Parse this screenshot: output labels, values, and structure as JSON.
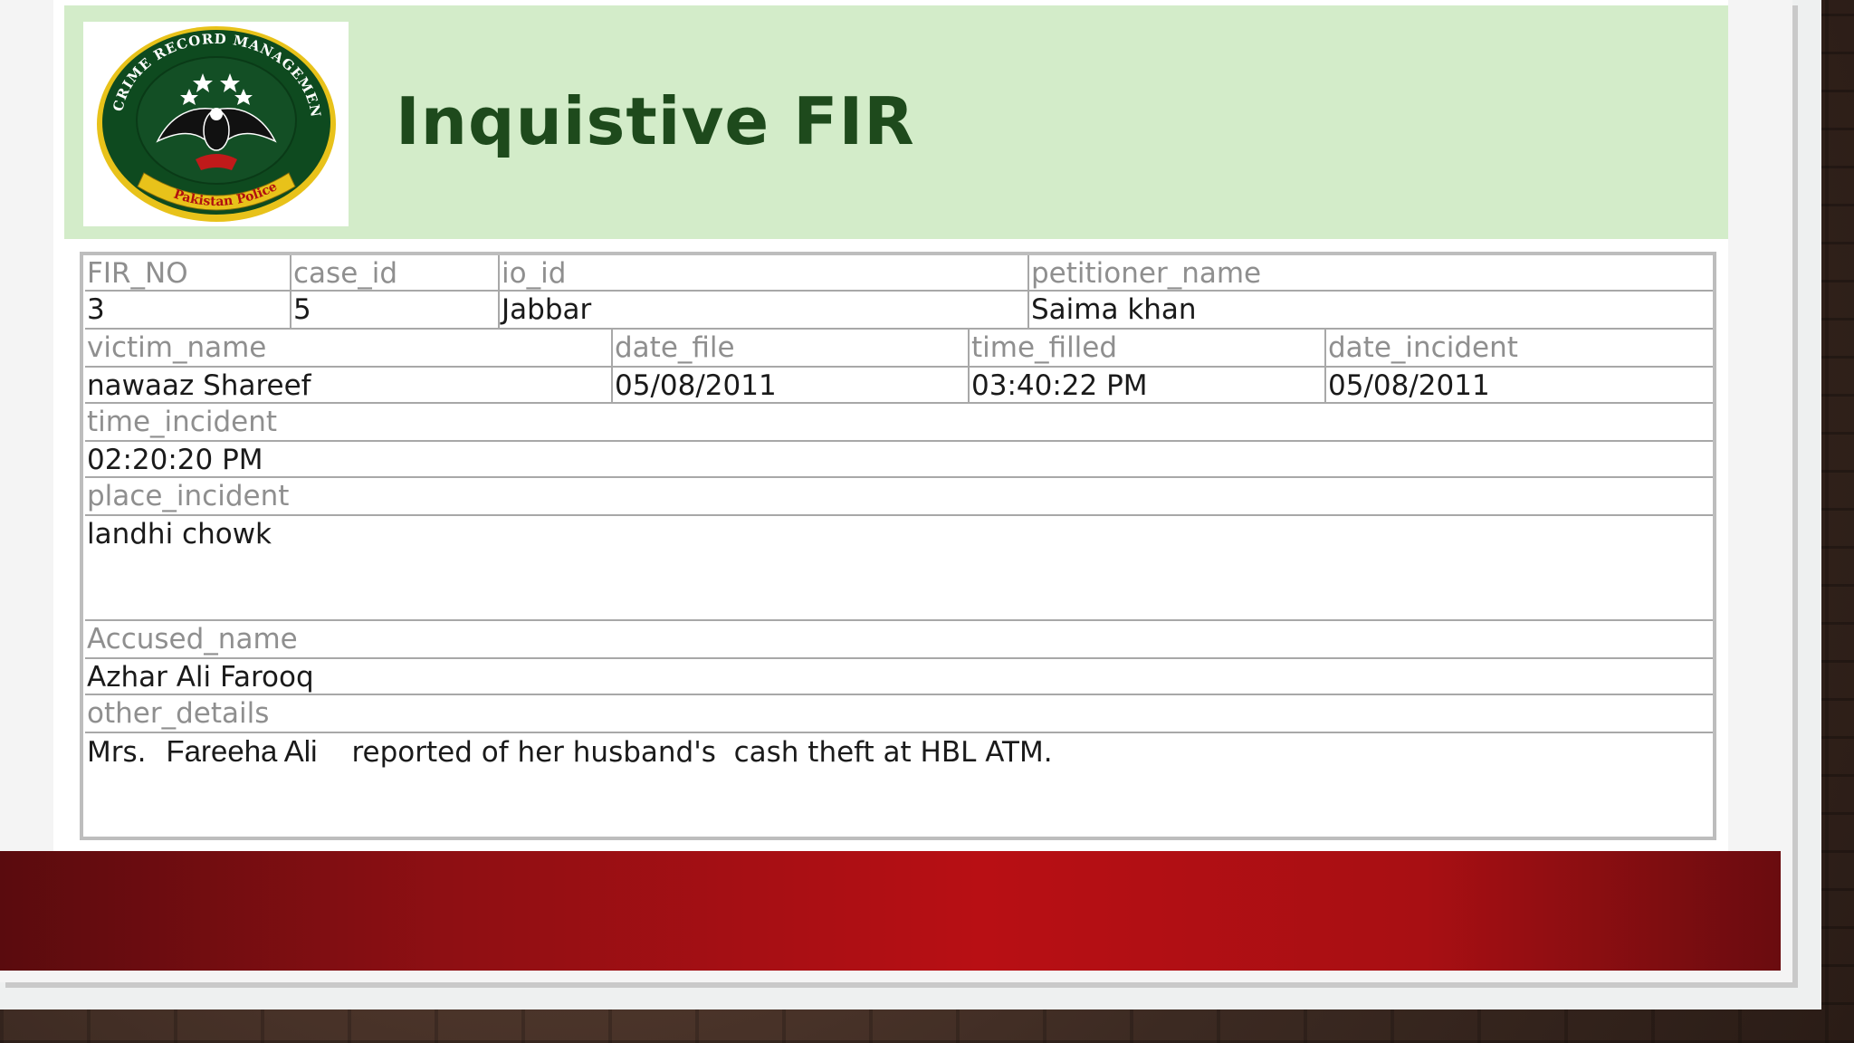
{
  "header": {
    "title": "Inquistive FIR",
    "logo": {
      "icon": "crime-record-management-system-seal",
      "ring_text": "CRIME RECORD MANAGEMENT SYSTEM",
      "banner_text": "Pakistan Police",
      "colors": {
        "ring": "#0e4a1f",
        "banner": "#e8c21a",
        "emblem": "#111111",
        "flag": "#c01a1a"
      }
    }
  },
  "form": {
    "row1": {
      "labels": [
        "FIR_NO",
        "case_id",
        "io_id",
        "petitioner_name"
      ],
      "values": [
        "3",
        "5",
        "Jabbar",
        "Saima khan"
      ]
    },
    "row2": {
      "labels": [
        "victim_name",
        "date_file",
        "time_filled",
        "date_incident"
      ],
      "values": [
        "nawaaz Shareef",
        "05/08/2011",
        "03:40:22 PM",
        "05/08/2011"
      ]
    },
    "time_incident": {
      "label": "time_incident",
      "value": "02:20:20 PM"
    },
    "place_incident": {
      "label": "place_incident",
      "value": "landhi chowk"
    },
    "accused_name": {
      "label": "Accused_name",
      "value": "Azhar Ali Farooq"
    },
    "other_details": {
      "label": "other_details",
      "value_prefix": "Mrs.",
      "value_name": "Fareeha Ali",
      "value_rest": "reported of her husband's  cash theft at HBL ATM."
    }
  },
  "colors": {
    "header_band": "#d3ecc9",
    "title": "#1e4a1c",
    "label_text": "#8f8f8f",
    "value_text": "#1a1a1a",
    "footer_band": "#b80f14"
  }
}
